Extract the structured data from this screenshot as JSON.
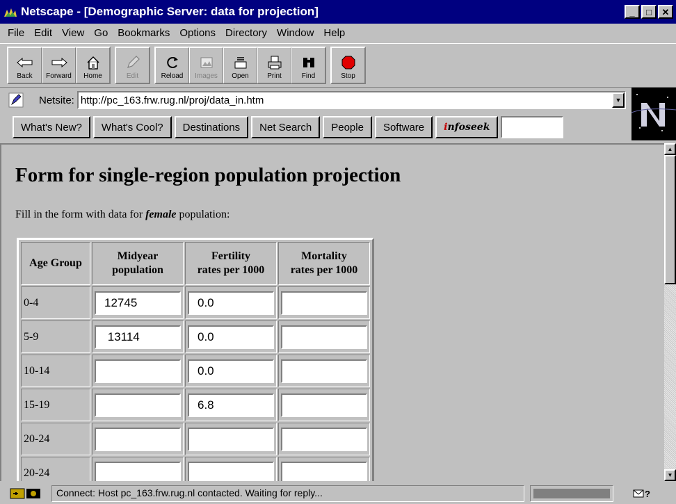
{
  "window": {
    "title": "Netscape - [Demographic Server: data for projection]",
    "controls": {
      "minimize": "_",
      "maximize": "□",
      "close": "✕"
    }
  },
  "menu": [
    {
      "label": "File"
    },
    {
      "label": "Edit"
    },
    {
      "label": "View"
    },
    {
      "label": "Go"
    },
    {
      "label": "Bookmarks"
    },
    {
      "label": "Options"
    },
    {
      "label": "Directory"
    },
    {
      "label": "Window"
    },
    {
      "label": "Help"
    }
  ],
  "toolbar": {
    "back": "Back",
    "forward": "Forward",
    "home": "Home",
    "edit": "Edit",
    "reload": "Reload",
    "images": "Images",
    "open": "Open",
    "print": "Print",
    "find": "Find",
    "stop": "Stop"
  },
  "location": {
    "label": "Netsite:",
    "url": "http://pc_163.frw.rug.nl/proj/data_in.htm"
  },
  "directory_buttons": {
    "whats_new": "What's New?",
    "whats_cool": "What's Cool?",
    "destinations": "Destinations",
    "net_search": "Net Search",
    "people": "People",
    "software": "Software",
    "infoseek_i": "i",
    "infoseek_rest": "nfoseek"
  },
  "page": {
    "title": "Form for single-region population projection",
    "intro_before": "Fill in the form with data for ",
    "intro_em": "female",
    "intro_after": " population:"
  },
  "table": {
    "headers": {
      "age": "Age Group",
      "midyear_1": "Midyear",
      "midyear_2": "population",
      "fertility_1": "Fertility",
      "fertility_2": "rates per 1000",
      "mortality_1": "Mortality",
      "mortality_2": "rates per 1000"
    },
    "rows": [
      {
        "age": "0-4",
        "population": "12745",
        "fertility": "0.0",
        "mortality": ""
      },
      {
        "age": "5-9",
        "population": " 13114",
        "fertility": "0.0",
        "mortality": ""
      },
      {
        "age": "10-14",
        "population": "",
        "fertility": "0.0",
        "mortality": ""
      },
      {
        "age": "15-19",
        "population": "",
        "fertility": "6.8",
        "mortality": ""
      },
      {
        "age": "20-24",
        "population": "",
        "fertility": "",
        "mortality": ""
      },
      {
        "age": "20-24",
        "population": "",
        "fertility": "",
        "mortality": ""
      }
    ]
  },
  "status": {
    "text": "Connect: Host pc_163.frw.rug.nl contacted. Waiting for reply..."
  },
  "colors": {
    "chrome": "#c0c0c0",
    "titlebar": "#000080",
    "stop_red": "#e00000"
  }
}
